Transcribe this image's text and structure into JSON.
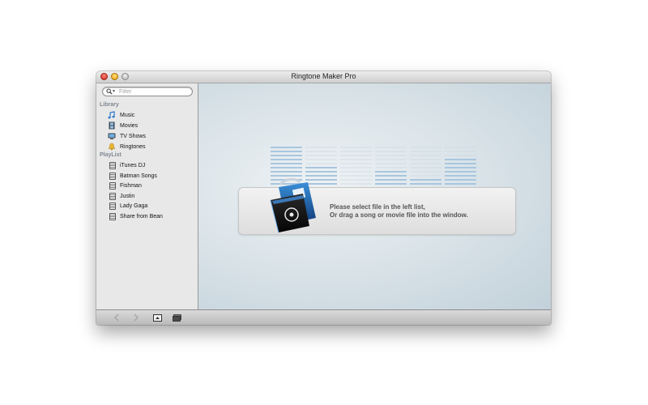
{
  "window": {
    "title": "Ringtone Maker Pro"
  },
  "search": {
    "placeholder": "Filter"
  },
  "sidebar": {
    "library_header": "Library",
    "library_items": [
      {
        "label": "Music",
        "icon": "music-note-icon"
      },
      {
        "label": "Movies",
        "icon": "film-icon"
      },
      {
        "label": "TV Shows",
        "icon": "tv-icon"
      },
      {
        "label": "Ringtones",
        "icon": "bell-icon"
      }
    ],
    "playlist_header": "PlayList",
    "playlist_items": [
      {
        "label": "iTunes DJ"
      },
      {
        "label": "Batman Songs"
      },
      {
        "label": "Fishman"
      },
      {
        "label": "Justin"
      },
      {
        "label": "Lady Gaga"
      },
      {
        "label": "Share from Bean"
      }
    ]
  },
  "main": {
    "message_line1": "Please select file in the left list,",
    "message_line2": "Or drag a song or movie file into the window."
  },
  "bottombar": {
    "back_icon": "chevron-left-icon",
    "forward_icon": "chevron-right-icon",
    "export_icon": "export-icon",
    "library_icon": "library-icon"
  },
  "colors": {
    "eq_bar": "#a8c6df",
    "sidebar_bg": "#e8e8e8",
    "main_bg": "#dbe4e9",
    "message_text": "#555555"
  }
}
